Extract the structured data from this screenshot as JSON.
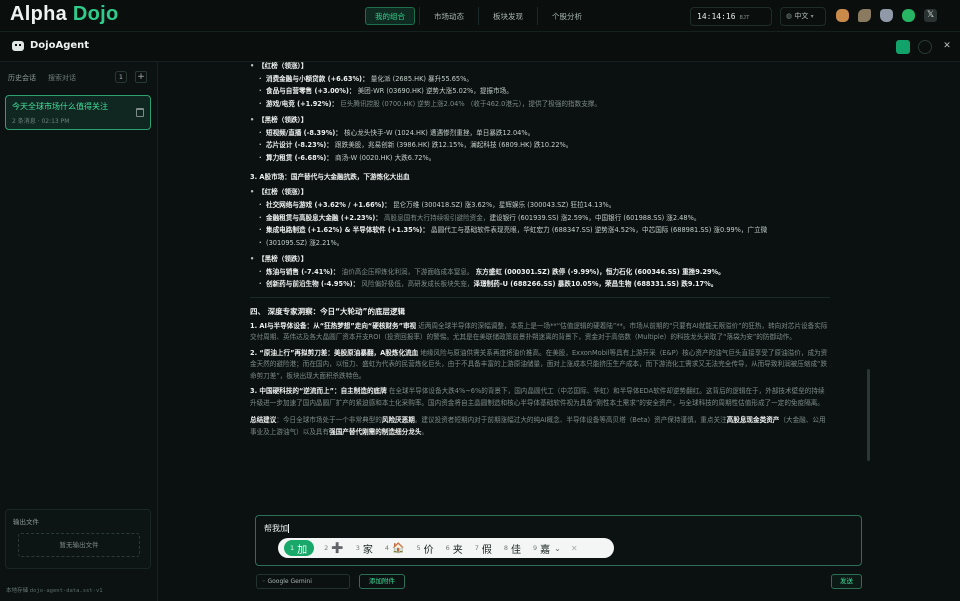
{
  "app": {
    "logo_part1": "Alpha",
    "logo_part2": "Dojo"
  },
  "nav": {
    "tabs": [
      {
        "label": "我的组合",
        "active": true
      },
      {
        "label": "市场动态",
        "active": false
      },
      {
        "label": "板块发现",
        "active": false
      },
      {
        "label": "个股分析",
        "active": false
      }
    ]
  },
  "status": {
    "time": "14:14:16",
    "timezone": "BJT",
    "language": "中文"
  },
  "agent": {
    "title": "DojoAgent"
  },
  "sidebar": {
    "tab_history": "历史会话",
    "search_placeholder": "搜索对话",
    "count": "1",
    "conversation": {
      "title": "今天全球市场什么值得关注",
      "meta": "2 条消息 · 02:13 PM"
    },
    "output_files_title": "输出文件",
    "output_files_empty": "暂无输出文件",
    "footer_label": "本地存储",
    "footer_value": "dojo-agent-data.sst-v1"
  },
  "content": {
    "l01": "【红榜（领涨）】",
    "l02a": "消费金融与小额贷款 (+6.63%)：",
    "l02b": "量化派 (2685.HK) 暴升55.65%。",
    "l03a": "食品与自营零售 (+3.00%)：",
    "l03b": "美团-WR (03690.HK) 逆势大涨5.02%，提振市场。",
    "l04a": "游戏/电竞 (+1.92%)：",
    "l04b": "巨头腾讯控股 (0700.HK) 逆势上涨2.04%",
    "l04c": "（收于462.0港元），提供了极强的指数支撑。",
    "l05": "【黑榜（领跌）】",
    "l06a": "短视频/直播 (-8.39%)：",
    "l06b": "核心龙头快手-W (1024.HK) 遭遇惨烈重挫，单日暴跌12.04%。",
    "l07a": "芯片设计 (-8.23%)：",
    "l07b": "跟跌美股，兆易创新 (3986.HK) 跌12.15%，澜起科技 (6809.HK) 跌10.22%。",
    "l08a": "算力租赁 (-6.68%)：",
    "l08b": "商汤-W (0020.HK) 大跌6.72%。",
    "l09": "3. A股市场：国产替代与大金融抗跌，下游炼化大出血",
    "l10": "【红榜（领涨）】",
    "l11a": "社交网络与游戏 (+3.62% / +1.66%)：",
    "l11b": "昆仑万维 (300418.SZ) 涨3.62%，星辉娱乐 (300043.SZ) 狂拉14.13%。",
    "l12a": "金融租赁与高股息大金融 (+2.23%)：",
    "l12b": "高股息国有大行持续吸引避险资金，",
    "l12c": "建设银行 (601939.SS) 涨2.59%，中国银行 (601988.SS) 涨2.48%。",
    "l13a": "集成电路制造 (+1.62%) & 半导体软件 (+1.35%)：",
    "l13b": "晶圆代工与基础软件表现亮眼，华虹宏力 (688347.SS) 逆势涨4.52%，中芯国际 (688981.SS) 涨0.99%，广立微",
    "l14": "(301095.SZ) 涨2.21%。",
    "l15": "【黑榜（领跌）】",
    "l16a": "炼油与销售 (-7.41%)：",
    "l16b": "油价高企压榨炼化利润，下游面临成本窒息。",
    "l16c": "东方盛虹 (000301.SZ) 跌停 (-9.99%)，恒力石化 (600346.SS) 重挫9.29%。",
    "l17a": "创新药与前沿生物 (-4.95%)：",
    "l17b": "风险偏好极低，高研发成长板块失宠，",
    "l17c": "泽璟制药-U (688266.SS) 暴跌10.05%，荣昌生物 (688331.SS) 跌9.17%。",
    "sec4": "四、 深度专家洞察：今日“大轮动”的底层逻辑",
    "p1a": "1. AI与半导体设备：从“狂热梦想”走向“硬核财务”审视",
    "p1b": "近两周全球半导体的深幅调整，本质上是一场**“估值逻辑的硬着陆”**。市场从前期的“只要有AI就能无限溢价”的狂热，转向对芯片设备实际交付周期、英伟达及各大晶圆厂资本开支ROI（投资回报率）的警惕。尤其是在美联储政策前景扑朔迷离的背景下，资金对于高倍数（Multiple）的科技龙头采取了“落袋为安”的防御动作。",
    "p2a": "2. “原油上行”再拟剪刀差：美股原油暴翻，A股炼化流血",
    "p2b": "地缘风险与原油供需关系再度将油价推高。在美股，ExxonMobil等具有上游开采（E&P）核心资产的油气巨头直接享受了原油溢价，成为资金天然的避险港；而在国内，以恒力、盛虹为代表的民营炼化巨头，由于不具备丰富的上游原油储量，面对上涨成本只能挤压生产成本，而下游消化工需求又无法完全传导，从而导致利润被压缩成“跌命剪刀差”，板块出现大面积杀跌特色。",
    "p3a": "3. 中国硬科技的“逆流而上”：自主制造的底牌",
    "p3b": "在全球半导体设备大跌4%~6%的背景下，国内晶圆代工（中芯国际、华虹）和半导体EDA软件却逆势翻红。这背后的逻辑在于，外部技术壁垒的持续升级进一步加速了国内晶圆厂扩产的紧迫感和本土化采购率。国内资金将自主晶圆制造和核心半导体基础软件视为具备“刚性本土需求”的安全资产，与全球科技的周期性估值形成了一定的免疫隔离。",
    "sum_label": "总结建议",
    "sum_a": "：今日全球市场处于一个非常典型的",
    "sum_b": "风险厌恶期",
    "sum_c": "。建议投资者短期内对于前期涨幅过大的纯AI概念、半导体设备等高贝塔（Beta）资产保持谨慎，重点关注",
    "sum_d": "高股息现金类资产",
    "sum_e": "（大金融、公用事业及上游油气）以及具有",
    "sum_f": "强国产替代刚需的制造细分龙头",
    "sum_g": "。"
  },
  "composer": {
    "input_value": "帮我加",
    "ime_candidates": [
      {
        "n": "1",
        "t": "加"
      },
      {
        "n": "2",
        "t": "➕"
      },
      {
        "n": "3",
        "t": "家"
      },
      {
        "n": "4",
        "t": "🏠"
      },
      {
        "n": "5",
        "t": "价"
      },
      {
        "n": "6",
        "t": "夹"
      },
      {
        "n": "7",
        "t": "假"
      },
      {
        "n": "8",
        "t": "佳"
      },
      {
        "n": "9",
        "t": "嘉"
      }
    ],
    "model": "Google Gemini",
    "attach_label": "添加附件",
    "send_label": "发送"
  },
  "colors": {
    "accent": "#2ecb8a",
    "background": "#0b1110"
  }
}
